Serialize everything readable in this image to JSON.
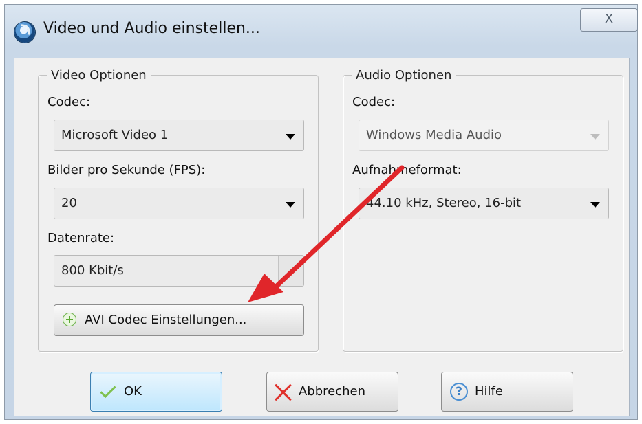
{
  "window": {
    "title": "Video und Audio einstellen...",
    "close_label": "X",
    "app_icon": "app-logo-icon"
  },
  "video": {
    "group_label": "Video Optionen",
    "codec_label": "Codec:",
    "codec_value": "Microsoft Video 1",
    "fps_label": "Bilder pro Sekunde (FPS):",
    "fps_value": "20",
    "rate_label": "Datenrate:",
    "rate_value": "800 Kbit/s",
    "avi_button": "AVI Codec Einstellungen..."
  },
  "audio": {
    "group_label": "Audio Optionen",
    "codec_label": "Codec:",
    "codec_value": "Windows Media Audio",
    "format_label": "Aufnahmeformat:",
    "format_value": "44.10 kHz, Stereo, 16-bit"
  },
  "buttons": {
    "ok": "OK",
    "cancel": "Abbrechen",
    "help": "Hilfe"
  },
  "colors": {
    "annotation_arrow": "#e0262a",
    "ok_icon": "#7fc14e",
    "cancel_icon": "#e0302a",
    "help_icon": "#4a8fd3"
  }
}
